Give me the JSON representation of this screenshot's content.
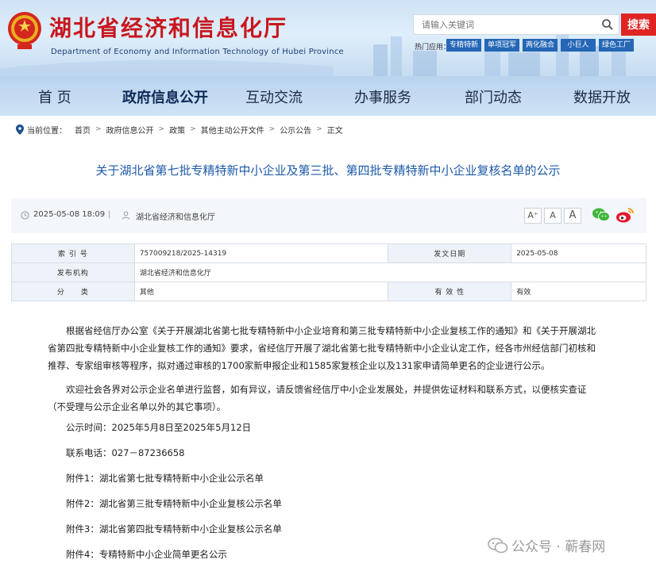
{
  "header": {
    "site_title": "湖北省经济和信息化厅",
    "site_subtitle": "Department of Economy and Information Technology of Hubei Province",
    "search_placeholder": "请输入关键词",
    "search_button": "搜索",
    "hot_label": "热门应用：",
    "hot_tags": [
      "专精特新",
      "单项冠军",
      "两化融合",
      "小巨人",
      "绿色工厂"
    ],
    "brand_color": "#c8161d"
  },
  "nav": {
    "items": [
      "首 页",
      "政府信息公开",
      "互动交流",
      "办事服务",
      "部门动态",
      "数据开放"
    ]
  },
  "breadcrumb": {
    "label": "当前位置：",
    "items": [
      "首页",
      "政府信息公开",
      "政策",
      "其他主动公开文件",
      "公示公告",
      "正文"
    ]
  },
  "article": {
    "title": "关于湖北省第七批专精特新中小企业及第三批、第四批专精特新中小企业复核名单的公示",
    "date": "2025-05-08 18:09",
    "divider": "|",
    "source": "湖北省经济和信息化厅",
    "font_buttons": [
      "A⁺",
      "A",
      "A"
    ]
  },
  "info_table": {
    "rows": [
      {
        "k1": "索 引 号",
        "v1": "757009218/2025-14319",
        "k2": "发文日期",
        "v2": "2025-05-08"
      },
      {
        "k1": "发布机构",
        "v1": "湖北省经济和信息化厅",
        "k2": "",
        "v2": ""
      },
      {
        "k1": "分　　类",
        "v1": "其他",
        "k2": "有 效 性",
        "v2": "有效"
      }
    ]
  },
  "body": {
    "para1": "根据省经信厅办公室《关于开展湖北省第七批专精特新中小企业培育和第三批专精特新中小企业复核工作的通知》和《关于开展湖北省第四批专精特新中小企业复核工作的通知》要求，省经信厅开展了湖北省第七批专精特新中小企业认定工作，经各市州经信部门初核和推荐、专家组审核等程序，拟对通过审核的1700家新申报企业和1585家复核企业以及131家申请简单更名的企业进行公示。",
    "para2": "欢迎社会各界对公示企业名单进行监督，如有异议，请反馈省经信厅中小企业发展处，并提供佐证材料和联系方式，以便核实查证（不受理与公示企业名单以外的其它事项）。",
    "period": "公示时间：2025年5月8日至2025年5月12日",
    "phone": "联系电话：027－87236658",
    "attach1": "附件1：湖北省第七批专精特新中小企业公示名单",
    "attach2": "附件2：湖北省第三批专精特新中小企业复核公示名单",
    "attach3": "附件3：湖北省第四批专精特新中小企业复核公示名单",
    "attach4": "附件4：专精特新中小企业简单更名公示"
  },
  "watermark": {
    "text": "公众号 · 蕲春网"
  }
}
